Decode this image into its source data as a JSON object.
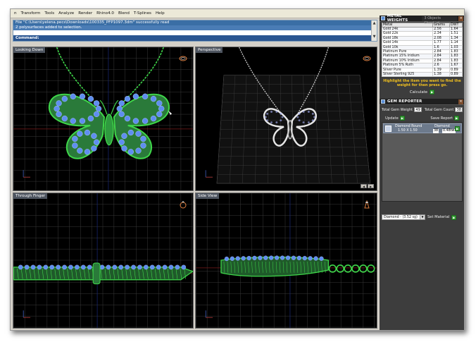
{
  "menu": [
    "n",
    "Transform",
    "Tools",
    "Analyze",
    "Render",
    "Rhino4.0",
    "Blend",
    "T-Splines",
    "Help"
  ],
  "command": {
    "lines": [
      "File \"C:\\Users\\yelena.pecs\\Downloads\\100335_PFP1097.3dm\" successfully read",
      "2 polysurfaces added to selection."
    ],
    "prompt": "Command:"
  },
  "viewports": {
    "top": {
      "title": "Looking Down"
    },
    "perspective": {
      "title": "Perspective"
    },
    "front": {
      "title": "Through Finger"
    },
    "side": {
      "title": "Side View"
    }
  },
  "metal_weights": {
    "title": "METAL WEIGHTS",
    "status": "3 Objects Checked",
    "columns": [
      "Metal",
      "Grams",
      "DWT"
    ],
    "rows": [
      [
        "Gold 24k",
        "2.56",
        "1.64"
      ],
      [
        "Gold 22k",
        "2.34",
        "1.51"
      ],
      [
        "Gold 18k",
        "2.08",
        "1.34"
      ],
      [
        "Gold 14k",
        "1.77",
        "1.14"
      ],
      [
        "Gold 10k",
        "1.6",
        "1.03"
      ],
      [
        "Platinum Pure",
        "2.84",
        "1.83"
      ],
      [
        "Platinum 15% Iridium",
        "2.84",
        "1.83"
      ],
      [
        "Platinum 10% Iridium",
        "2.84",
        "1.83"
      ],
      [
        "Platinum 5% Ruth",
        "2.6",
        "1.67"
      ],
      [
        "Silver Pure",
        "1.39",
        "0.89"
      ],
      [
        "Silver Sterling 925",
        "1.38",
        "0.89"
      ]
    ],
    "hint": "Highlight the item you want to find the weight for then press go.",
    "calculate_label": "Calculate"
  },
  "gem_reporter": {
    "title": "GEM REPORTER",
    "total_weight_label": "Total Gem Weight",
    "total_weight": "49",
    "total_count_label": "Total Gem Count",
    "total_count": "38",
    "update_label": "Update",
    "save_report_label": "Save Report",
    "items": [
      {
        "cut": "Diamond Round",
        "size": "1.50 X 1.50",
        "material": "Diamond",
        "count": "38",
        "weight": "0.48tw"
      }
    ],
    "material_select": "Diamond - (3.52 sg)",
    "set_material_label": "Set Material"
  },
  "colors": {
    "viewport_bg": "#000000",
    "grid": "#3a3a3a",
    "model_green": "#3fd84a",
    "gem_blue": "#5f8ef0",
    "hint_yellow": "#f0c020",
    "cmd_blue": "#3a6ea5"
  },
  "icons": [
    "ring-icon",
    "close-icon",
    "go-icon",
    "panel-icon",
    "gem-thumbnail-icon",
    "dropdown-icon",
    "axis-icon"
  ]
}
